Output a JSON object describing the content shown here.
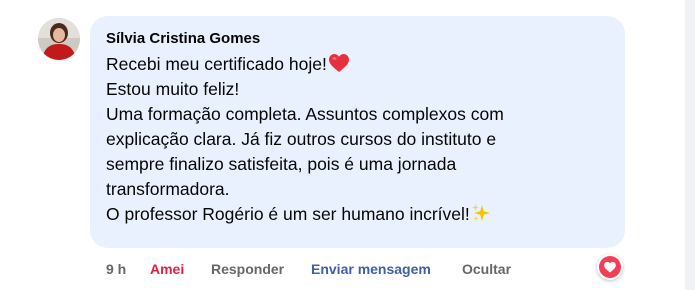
{
  "comment": {
    "author": "Sílvia Cristina Gomes",
    "lines": [
      "Recebi meu certificado hoje!",
      "Estou muito feliz!",
      "Uma formação completa. Assuntos complexos com",
      "explicação clara. Já fiz outros cursos do instituto e",
      "sempre finalizo satisfeita, pois é uma jornada",
      "transformadora.",
      "O professor Rogério é um ser humano incrível!"
    ],
    "emoji_heart": "heart-emoji",
    "emoji_sparkles": "sparkles-emoji"
  },
  "actions": {
    "time": "9 h",
    "love": "Amei",
    "reply": "Responder",
    "send_message": "Enviar mensagem",
    "hide": "Ocultar"
  },
  "reaction": {
    "icon": "heart-reaction-icon",
    "color": "#f33e58"
  },
  "colors": {
    "bubble": "#e9f1fe",
    "love": "#e41e3f",
    "send_message": "#3f5fa6",
    "muted": "#65676b"
  }
}
